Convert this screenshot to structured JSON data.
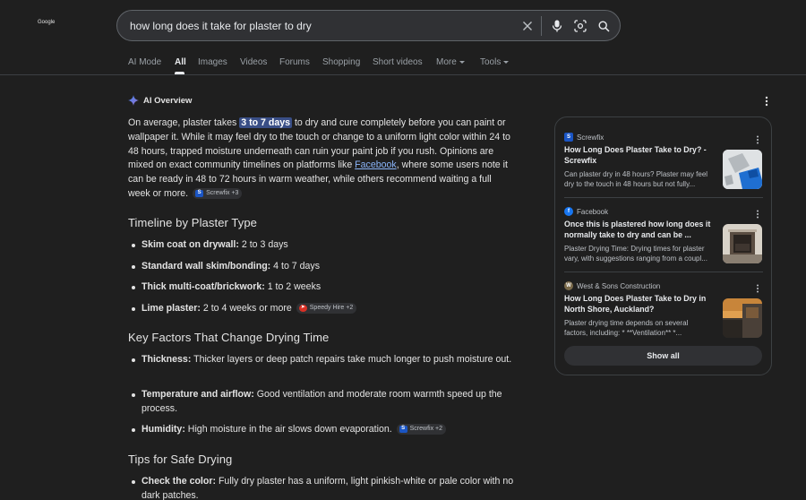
{
  "header": {
    "logo_text": "Google",
    "search_query": "how long does it take for plaster to dry",
    "icons": [
      "close-icon",
      "microphone-icon",
      "lens-icon",
      "search-icon"
    ]
  },
  "tabs": [
    {
      "label": "AI Mode",
      "active": false
    },
    {
      "label": "All",
      "active": true
    },
    {
      "label": "Images",
      "active": false
    },
    {
      "label": "Videos",
      "active": false
    },
    {
      "label": "Forums",
      "active": false
    },
    {
      "label": "Shopping",
      "active": false
    },
    {
      "label": "Short videos",
      "active": false
    },
    {
      "label": "More",
      "active": false
    },
    {
      "label": "Tools",
      "active": false
    }
  ],
  "ai_overview": {
    "title": "AI Overview",
    "intro": {
      "p1": "On average, plaster takes ",
      "highlight": "3 to 7 days",
      "p2": " to dry and cure completely before you can paint or wallpaper it. While it may feel dry to the touch or change to a uniform light color within 24 to 48 hours, trapped moisture underneath can ruin your paint job if you rush. Opinions are mixed on exact community timelines on platforms like ",
      "link": "Facebook",
      "p3": ", where some users note it can be ready in 48 to 72 hours in warm weather, while others recommend waiting a full week or more.",
      "chip": "Screwfix +3"
    },
    "sections": [
      {
        "heading": "Timeline by Plaster Type",
        "items": [
          {
            "bold": "Skim coat on drywall:",
            "text": " 2 to 3 days"
          },
          {
            "bold": "Standard wall skim/bonding:",
            "text": " 4 to 7 days"
          },
          {
            "bold": "Thick multi-coat/brickwork:",
            "text": " 1 to 2 weeks"
          },
          {
            "bold": "Lime plaster:",
            "text": " 2 to 4 weeks or more",
            "chip": "Speedy Hire +2"
          }
        ]
      },
      {
        "heading": "Key Factors That Change Drying Time",
        "items": [
          {
            "bold": "Thickness:",
            "text": " Thicker layers or deep patch repairs take much longer to push moisture out."
          },
          {
            "bold": "Temperature and airflow:",
            "text": " Good ventilation and moderate room warmth speed up the process."
          },
          {
            "bold": "Humidity:",
            "text": " High moisture in the air slows down evaporation.",
            "chip": "Screwfix +2"
          }
        ]
      },
      {
        "heading": "Tips for Safe Drying",
        "items": [
          {
            "bold": "Check the color:",
            "text": " Fully dry plaster has a uniform, light pinkish-white or pale color with no dark patches."
          }
        ]
      }
    ]
  },
  "sources": {
    "items": [
      {
        "site": "Screwfix",
        "title": "How Long Does Plaster Take to Dry? - Screwfix",
        "snippet": "Can plaster dry in 48 hours? Plaster may feel dry to the touch in 48 hours but not fully..."
      },
      {
        "site": "Facebook",
        "title": "Once this is plastered how long does it normally take to dry and can be ...",
        "snippet": "Plaster Drying Time: Drying times for plaster vary, with suggestions ranging from a coupl..."
      },
      {
        "site": "West & Sons Construction",
        "title": "How Long Does Plaster Take to Dry in North Shore, Auckland?",
        "snippet": "Plaster drying time depends on several factors, including: * **Ventilation** *..."
      }
    ],
    "show_all": "Show all"
  },
  "colors": {
    "background": "#1f1f1f",
    "link": "#8ab4f8",
    "highlight": "#394e86",
    "surface": "#303134"
  }
}
